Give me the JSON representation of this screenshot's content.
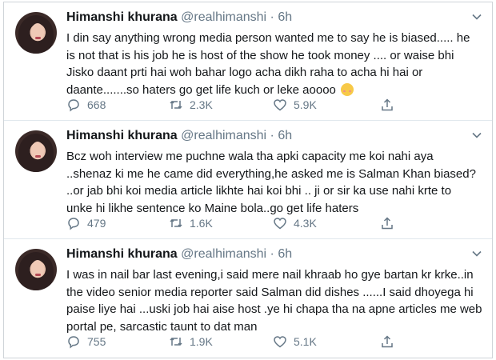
{
  "tweets": [
    {
      "name": "Himanshi khurana",
      "handle": "@realhimanshi · 6h",
      "lines": [
        "I din say anything wrong media person wanted me to say he is biased..... he",
        "is not that is his job he is host of the show he took money .... or waise bhi",
        "Jisko daant prti hai woh bahar logo acha dikh raha to acha hi hai or",
        "daante.......so haters go get life kuch or leke aoooo"
      ],
      "replies": "668",
      "retweets": "2.3K",
      "likes": "5.9K"
    },
    {
      "name": "Himanshi khurana",
      "handle": "@realhimanshi · 6h",
      "lines": [
        "Bcz woh interview me puchne wala tha apki capacity me koi nahi aya",
        "..shenaz ki me he came did everything,he asked me is Salman Khan biased?",
        "..or jab bhi koi media article likhte hai koi bhi .. ji or sir ka use nahi krte to",
        "unke hi likhe sentence ko Maine bola..go get life haters"
      ],
      "replies": "479",
      "retweets": "1.6K",
      "likes": "4.3K"
    },
    {
      "name": "Himanshi khurana",
      "handle": "@realhimanshi · 6h",
      "lines": [
        "I was in nail bar last evening,i said mere nail khraab ho gye bartan kr krke..in",
        "the video senior media reporter said Salman did dishes ......I said dhoyega hi",
        "paise liye hai ...uski job hai aise host .ye hi chapa tha na apne articles me web",
        "portal pe, sarcastic taunt to dat man"
      ],
      "replies": "755",
      "retweets": "1.9K",
      "likes": "5.1K"
    }
  ]
}
